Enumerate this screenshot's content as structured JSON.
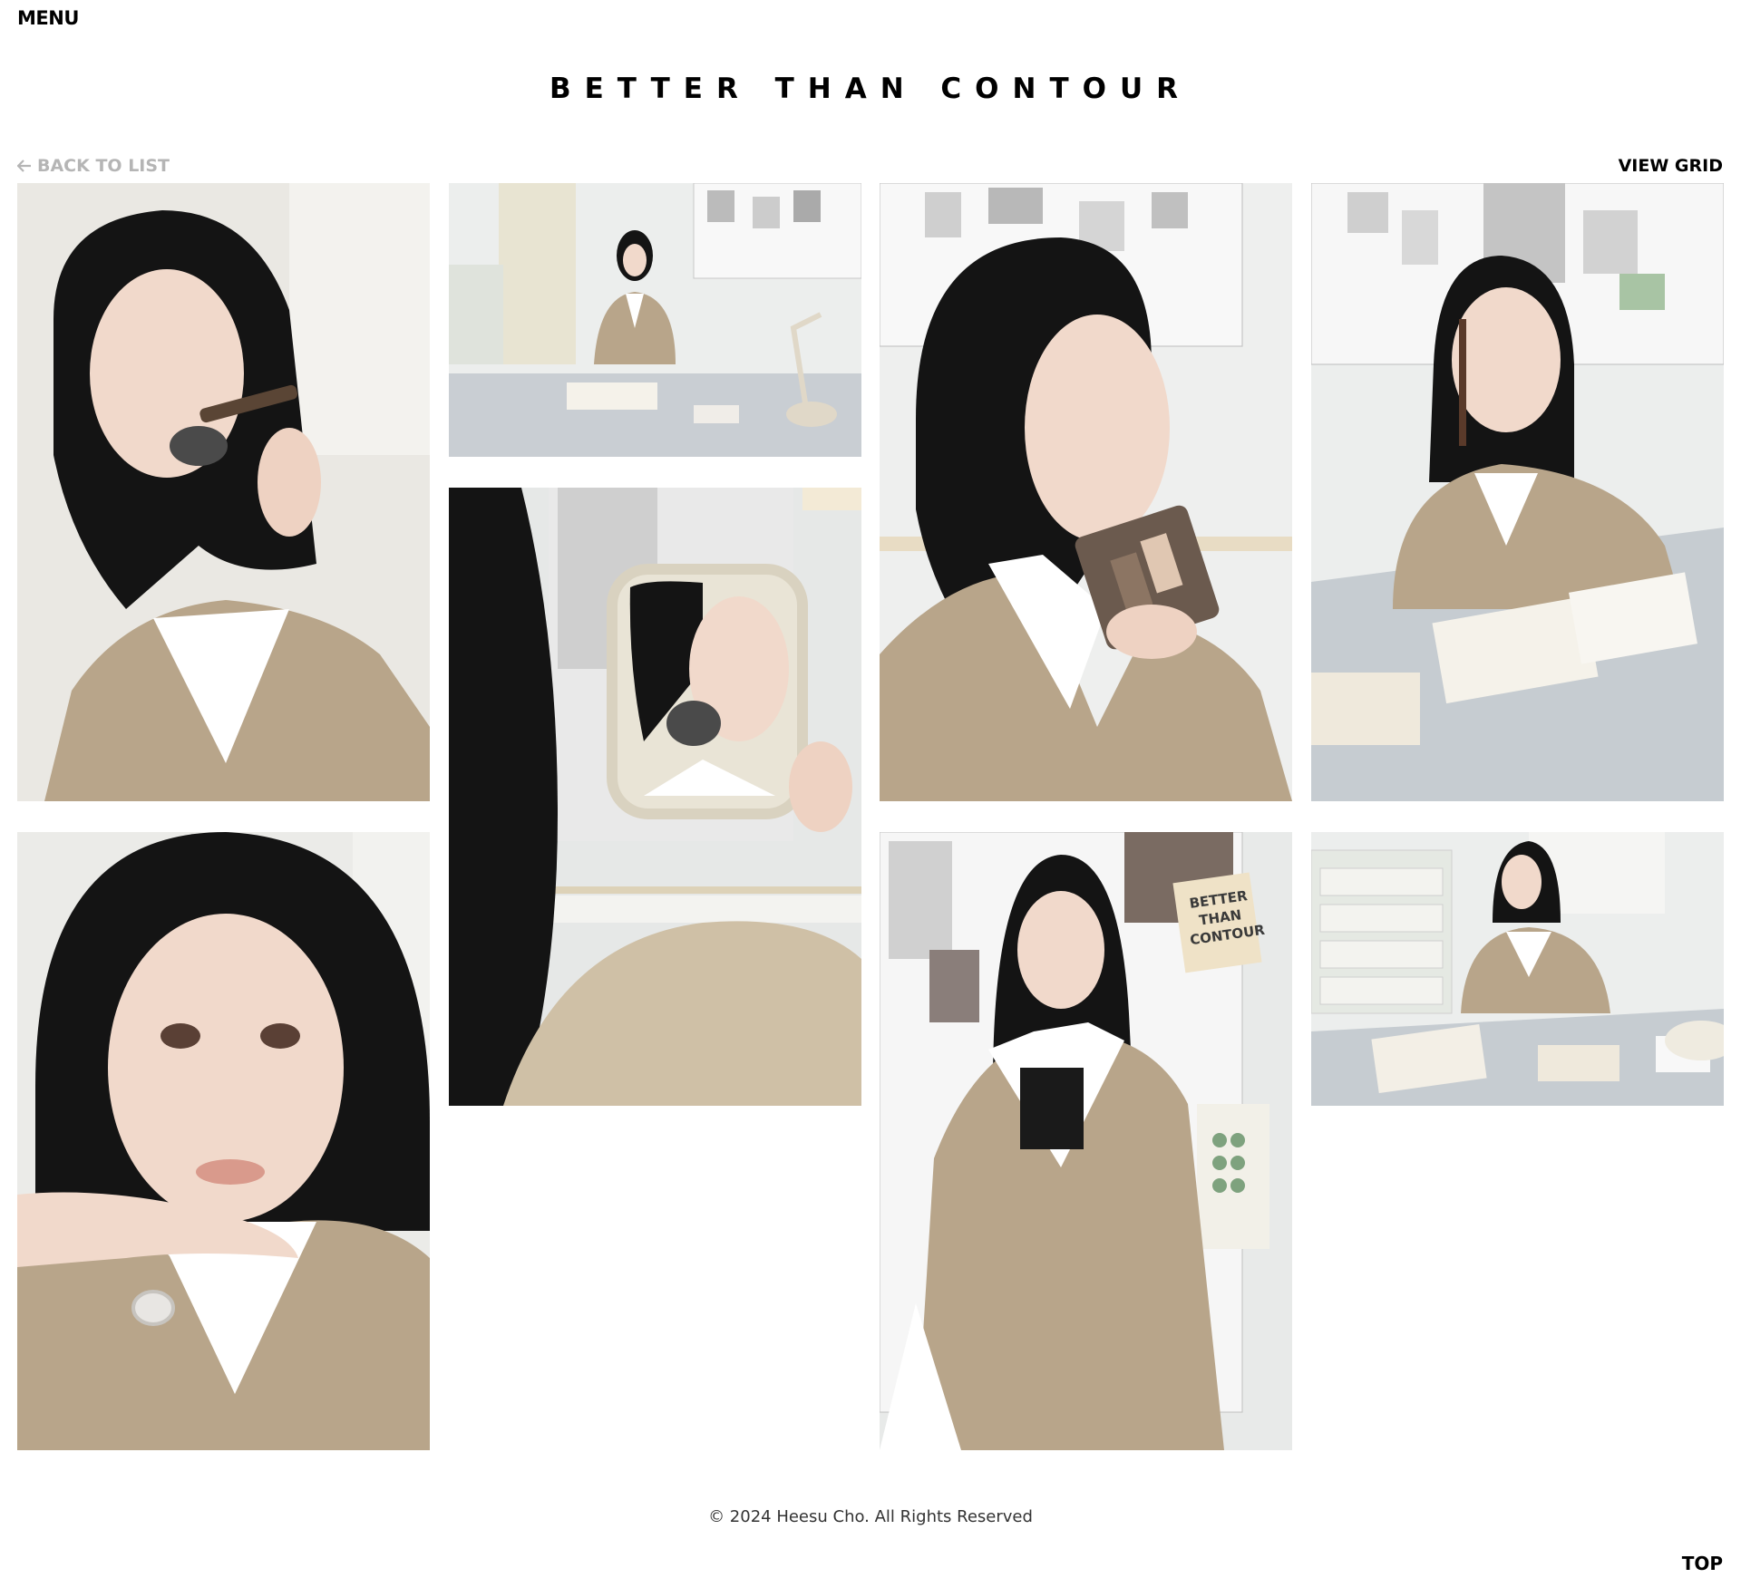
{
  "header": {
    "menu_label": "MENU",
    "title": "BETTER THAN CONTOUR"
  },
  "nav": {
    "back_label": "BACK TO LIST",
    "back_icon": "arrow-left-icon",
    "view_grid_label": "VIEW GRID"
  },
  "gallery": {
    "photos": [
      {
        "name": "photo-brush-jaw"
      },
      {
        "name": "photo-desk-wide"
      },
      {
        "name": "photo-palette-hold"
      },
      {
        "name": "photo-pencil-desk"
      },
      {
        "name": "photo-mirror-reflection"
      },
      {
        "name": "photo-closeup-hands"
      },
      {
        "name": "photo-standing-board"
      },
      {
        "name": "photo-desk-side"
      }
    ],
    "poster_text": "BETTER THAN CONTOUR"
  },
  "footer": {
    "copyright": "© 2024 Heesu Cho. All Rights Reserved",
    "top_label": "TOP"
  },
  "colors": {
    "back_link": "#b5b5b5",
    "jacket": "#b8a58a",
    "hair": "#141414",
    "skin": "#f1d9cb",
    "shirt": "#ffffff"
  }
}
